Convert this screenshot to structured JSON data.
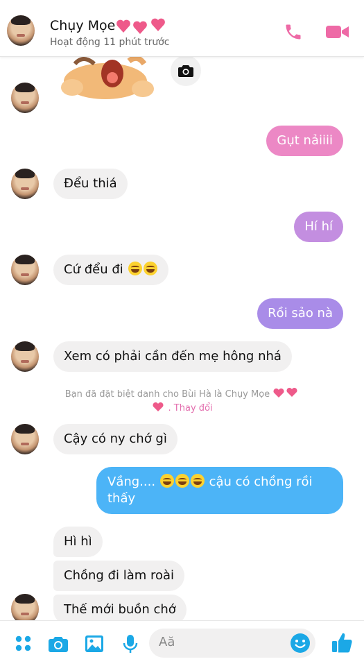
{
  "header": {
    "name": "Chụy Mọe",
    "status": "Hoạt động 11 phút trước",
    "accent_color": "#e36eae"
  },
  "messages": [
    {
      "side": "out",
      "text": "Gụt nảiiii",
      "color": "#ec88c5"
    },
    {
      "side": "in",
      "text": "Đểu thiá"
    },
    {
      "side": "out",
      "text": "Hí hí",
      "color": "#c38ee0"
    },
    {
      "side": "in",
      "text": "Cứ đểu đi"
    },
    {
      "side": "out",
      "text": "Rồi sảo nà",
      "color": "#a98ce8"
    },
    {
      "side": "in",
      "text": "Xem có phải cần đến mẹ hông nhá"
    },
    {
      "side": "in",
      "text": "Cậy có ny chớ gì"
    },
    {
      "side": "out",
      "text_a": "Vầng....",
      "text_b": "cậu có chồng rồi",
      "text_c": "thấy",
      "color": "#4cb4f7"
    },
    {
      "side": "in",
      "text": "Hì hì"
    },
    {
      "side": "in",
      "text": "Chồng đi làm roài"
    },
    {
      "side": "in",
      "text": "Thế mới buồn chớ"
    }
  ],
  "notice": {
    "text": "Bạn đã đặt biệt danh cho Bùi Hà là Chụy Mọe",
    "link": ". Thay đổi"
  },
  "composer": {
    "placeholder": "Aă",
    "icons": [
      "apps-icon",
      "camera-icon",
      "gallery-icon",
      "microphone-icon",
      "emoji-icon",
      "like-icon"
    ],
    "icon_color": "#1ba8e6"
  }
}
